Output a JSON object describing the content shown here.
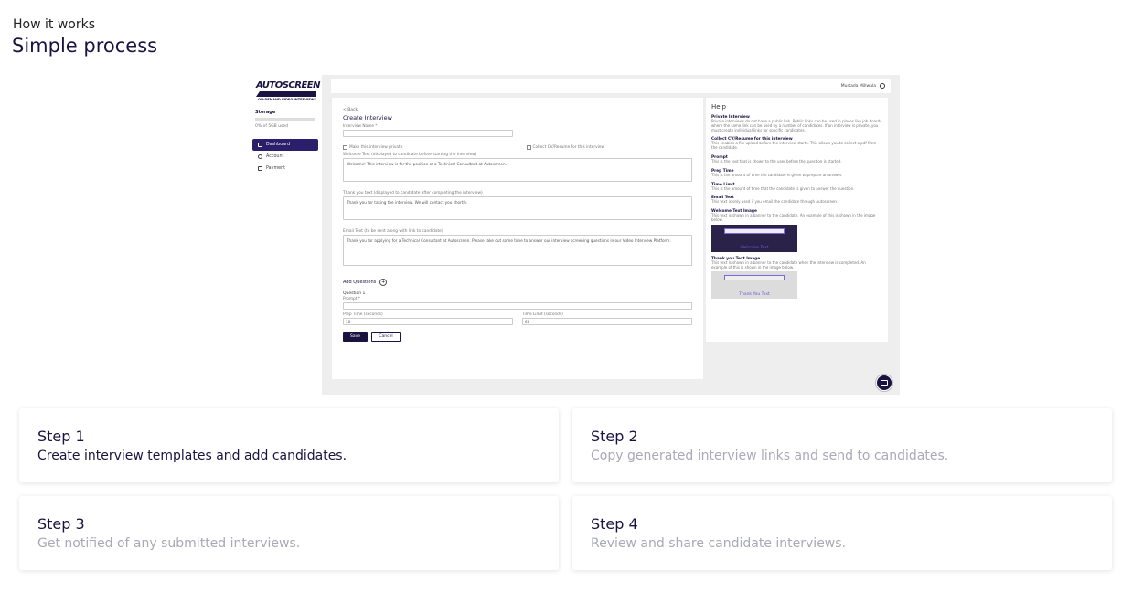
{
  "intro": {
    "eyebrow": "How it works",
    "headline": "Simple process"
  },
  "screenshot": {
    "logo": {
      "text": "AUTOSCREEN",
      "subtitle": "ON-DEMAND VIDEO INTERVIEWS"
    },
    "user_name": "Murtada Millwala",
    "storage": {
      "title": "Storage",
      "used": "0% of 5GB used",
      "fraction": 0.0
    },
    "nav": [
      {
        "label": "Dashboard",
        "icon": "home-icon",
        "active": true
      },
      {
        "label": "Account",
        "icon": "gear-icon",
        "active": false
      },
      {
        "label": "Payment",
        "icon": "card-icon",
        "active": false
      }
    ],
    "form": {
      "back": "< Back",
      "title": "Create Interview",
      "name_label": "Interview Name *",
      "private_check": "Make this interview private",
      "cv_check": "Collect CV/Resume for this interview",
      "welcome_label": "Welcome Text (displayed to candidate before starting the interview)",
      "welcome_value": "Welcome! This interview is for the position of a Technical Consultant at Autoscreen.",
      "thanks_label": "Thank you text (displayed to candidate after completing the interview)",
      "thanks_value": "Thank you for taking the interview. We will contact you shortly.",
      "email_label": "Email Text (to be sent along with link to candidate)",
      "email_value": "Thank you for applying for a Technical Consultant at Autoscreen. Please take out some time to answer our interview screening questions in our Video Interview Platform.",
      "add_questions": "Add Questions",
      "question_title": "Question 1",
      "prompt_label": "Prompt *",
      "prep_label": "Prep Time (seconds)",
      "prep_value": "10",
      "limit_label": "Time Limit (seconds)",
      "limit_value": "60",
      "save": "Save",
      "cancel": "Cancel"
    },
    "help": {
      "title": "Help",
      "sections": [
        {
          "head": "Private Interview",
          "body": "Private interviews do not have a public link. Public links can be used in places like job boards where the same link can be used by a number of candidates. If an interview is private, you must create individual links for specific candidates."
        },
        {
          "head": "Collect CV/Resume for this interview",
          "body": "This enables a file upload before the interview starts. This allows you to collect a pdf from the candidate."
        },
        {
          "head": "Prompt",
          "body": "This is the text that is shown to the user before the question is started."
        },
        {
          "head": "Prep Time",
          "body": "This is the amount of time the candidate is given to prepare an answer."
        },
        {
          "head": "Time Limit",
          "body": "This is the amount of time that the candidate is given to answer the question."
        },
        {
          "head": "Email Text",
          "body": "This text is only used if you email the candidate through Autoscreen."
        },
        {
          "head": "Welcome Text Image",
          "body": "This text is shown in a banner to the candidate. An example of this is shown in the image below.",
          "caption": "Welcome Text"
        },
        {
          "head": "Thank you Text Image",
          "body": "This text is shown in a banner to the candidate when the interview is completed. An example of this is shown in the image below.",
          "caption": "Thank You Text"
        }
      ]
    }
  },
  "steps": [
    {
      "title": "Step 1",
      "desc": "Create interview templates and add candidates.",
      "desc_color": "#1a1240"
    },
    {
      "title": "Step 2",
      "desc": "Copy generated interview links and send to candidates.",
      "desc_color": "#a9a9b8"
    },
    {
      "title": "Step 3",
      "desc": "Get notified of any submitted interviews.",
      "desc_color": "#a9a9b8"
    },
    {
      "title": "Step 4",
      "desc": "Review and share candidate interviews.",
      "desc_color": "#a9a9b8"
    }
  ]
}
